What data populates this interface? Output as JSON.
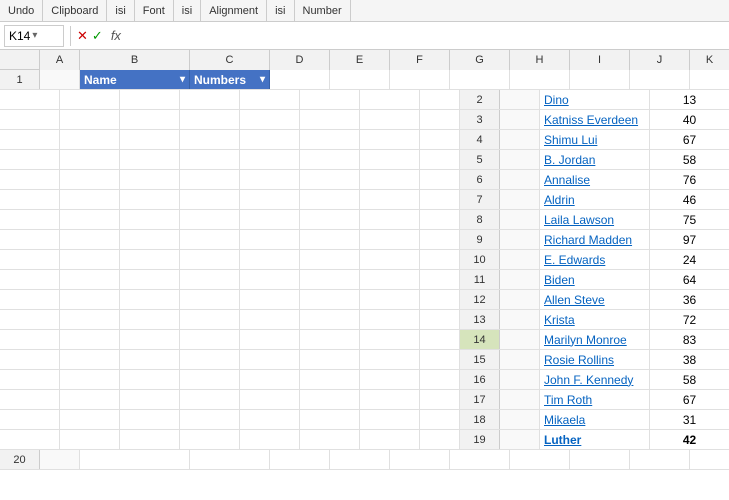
{
  "toolbar": {
    "sections": [
      "Undo",
      "Clipboard",
      "isi",
      "Font",
      "isi",
      "Alignment",
      "isi",
      "Number"
    ]
  },
  "formulaBar": {
    "cellRef": "K14",
    "icons": [
      "✕",
      "✓",
      "fx"
    ],
    "value": ""
  },
  "columns": {
    "A": {
      "label": ""
    },
    "B": {
      "label": "Name"
    },
    "C": {
      "label": "Numbers"
    },
    "D": {
      "label": "D"
    },
    "E": {
      "label": "E"
    },
    "F": {
      "label": "F"
    },
    "G": {
      "label": "G"
    },
    "H": {
      "label": "H"
    },
    "I": {
      "label": "I"
    },
    "J": {
      "label": "J"
    },
    "K": {
      "label": "K"
    }
  },
  "rows": [
    {
      "row": 2,
      "name": "Dino",
      "number": "13"
    },
    {
      "row": 3,
      "name": "Katniss Everdeen",
      "number": "40"
    },
    {
      "row": 4,
      "name": "Shimu Lui",
      "number": "67"
    },
    {
      "row": 5,
      "name": "B. Jordan",
      "number": "58"
    },
    {
      "row": 6,
      "name": "Annalise",
      "number": "76"
    },
    {
      "row": 7,
      "name": "Aldrin",
      "number": "46"
    },
    {
      "row": 8,
      "name": "Laila Lawson",
      "number": "75"
    },
    {
      "row": 9,
      "name": "Richard Madden",
      "number": "97"
    },
    {
      "row": 10,
      "name": "E. Edwards",
      "number": "24"
    },
    {
      "row": 11,
      "name": "Biden",
      "number": "64"
    },
    {
      "row": 12,
      "name": "Allen Steve",
      "number": "36"
    },
    {
      "row": 13,
      "name": "Krista",
      "number": "72"
    },
    {
      "row": 14,
      "name": "Marilyn Monroe",
      "number": "83"
    },
    {
      "row": 15,
      "name": "Rosie Rollins",
      "number": "38"
    },
    {
      "row": 16,
      "name": "John F. Kennedy",
      "number": "58"
    },
    {
      "row": 17,
      "name": "Tim Roth",
      "number": "67"
    },
    {
      "row": 18,
      "name": "Mikaela",
      "number": "31"
    },
    {
      "row": 19,
      "name": "Luther",
      "number": "42",
      "bold": true
    }
  ],
  "tableHeaderName": "Name",
  "tableHeaderNumbers": "Numbers"
}
